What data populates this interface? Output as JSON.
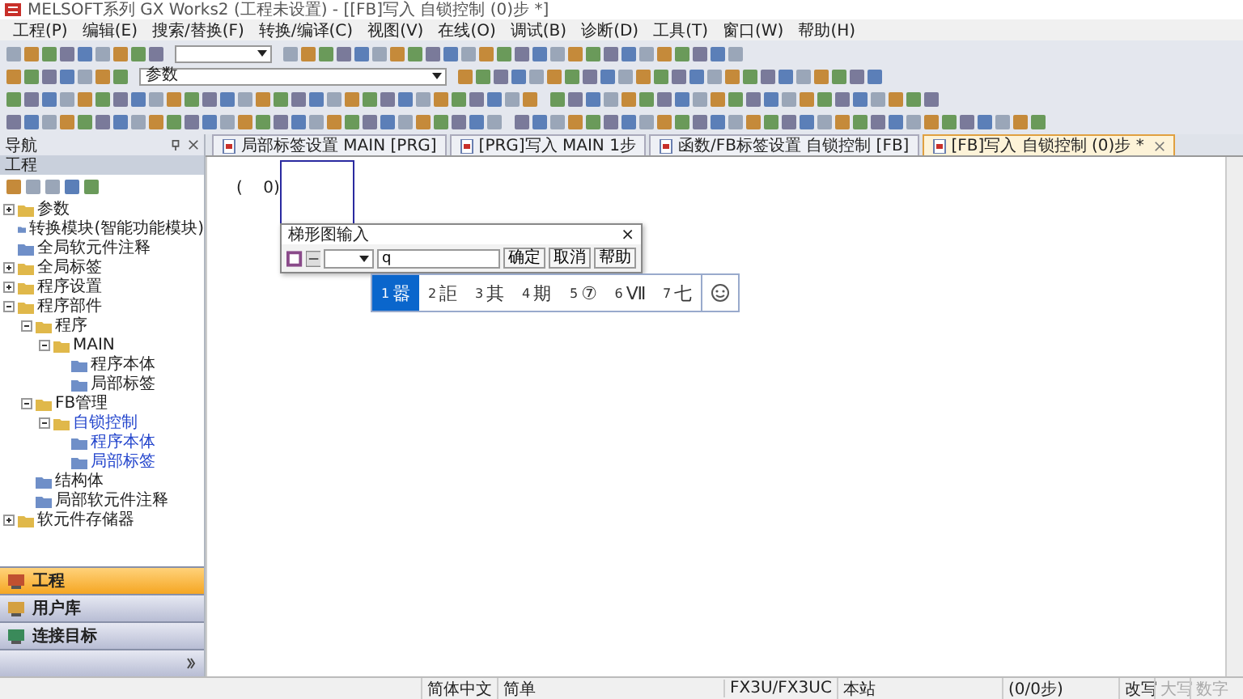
{
  "window": {
    "title": "MELSOFT系列 GX Works2 (工程未设置) - [[FB]写入 自锁控制 (0)步 *]"
  },
  "menu": [
    "工程(P)",
    "编辑(E)",
    "搜索/替换(F)",
    "转换/编译(C)",
    "视图(V)",
    "在线(O)",
    "调试(B)",
    "诊断(D)",
    "工具(T)",
    "窗口(W)",
    "帮助(H)"
  ],
  "toolbar": {
    "parameter_dropdown": "参数"
  },
  "navigation": {
    "title": "导航",
    "panel_title": "工程",
    "tree": [
      {
        "label": "参数",
        "expanded": false,
        "selected": false
      },
      {
        "label": "转换模块(智能功能模块)",
        "selected": false
      },
      {
        "label": "全局软元件注释",
        "selected": false
      },
      {
        "label": "全局标签",
        "expanded": false,
        "selected": false
      },
      {
        "label": "程序设置",
        "expanded": false,
        "selected": false
      },
      {
        "label": "程序部件",
        "expanded": true,
        "selected": false,
        "children": [
          {
            "label": "程序",
            "expanded": true,
            "selected": false,
            "children": [
              {
                "label": "MAIN",
                "expanded": true,
                "selected": false,
                "children": [
                  {
                    "label": "程序本体",
                    "selected": false
                  },
                  {
                    "label": "局部标签",
                    "selected": false
                  }
                ]
              }
            ]
          },
          {
            "label": "FB管理",
            "expanded": true,
            "selected": false,
            "children": [
              {
                "label": "自锁控制",
                "expanded": true,
                "selected": true,
                "children": [
                  {
                    "label": "程序本体",
                    "selected": true
                  },
                  {
                    "label": "局部标签",
                    "selected": true
                  }
                ]
              }
            ]
          },
          {
            "label": "结构体",
            "selected": false
          },
          {
            "label": "局部软元件注释",
            "selected": false
          }
        ]
      },
      {
        "label": "软元件存储器",
        "expanded": false,
        "selected": false
      }
    ],
    "panels": [
      {
        "label": "工程",
        "selected": true
      },
      {
        "label": "用户库",
        "selected": false
      },
      {
        "label": "连接目标",
        "selected": false
      }
    ]
  },
  "tabs": [
    {
      "label": "局部标签设置 MAIN [PRG]",
      "selected": false
    },
    {
      "label": "[PRG]写入 MAIN 1步",
      "selected": false
    },
    {
      "label": "函数/FB标签设置 自锁控制 [FB]",
      "selected": false
    },
    {
      "label": "[FB]写入 自锁控制 (0)步 *",
      "selected": true
    }
  ],
  "ladder": {
    "step": "(    0)"
  },
  "ladder_input_dialog": {
    "title": "梯形图输入",
    "close": "×",
    "value": "q",
    "buttons": [
      "确定",
      "取消",
      "帮助"
    ]
  },
  "ime_candidates": [
    {
      "index": "1",
      "text": "嚣",
      "selected": true
    },
    {
      "index": "2",
      "text": "詎",
      "selected": false
    },
    {
      "index": "3",
      "text": "其",
      "selected": false
    },
    {
      "index": "4",
      "text": "期",
      "selected": false
    },
    {
      "index": "5",
      "text": "⑦",
      "selected": false
    },
    {
      "index": "6",
      "text": "Ⅶ",
      "selected": false
    },
    {
      "index": "7",
      "text": "七",
      "selected": false
    }
  ],
  "status_bar": [
    {
      "text": "简体中文",
      "disabled": false
    },
    {
      "text": "简单",
      "disabled": false
    },
    {
      "text": "FX3U/FX3UC",
      "disabled": false
    },
    {
      "text": "本站",
      "disabled": false
    },
    {
      "text": "(0/0步)",
      "disabled": false
    },
    {
      "text": "改写",
      "disabled": false
    },
    {
      "text": "大写",
      "disabled": true
    },
    {
      "text": "数字",
      "disabled": true
    }
  ]
}
